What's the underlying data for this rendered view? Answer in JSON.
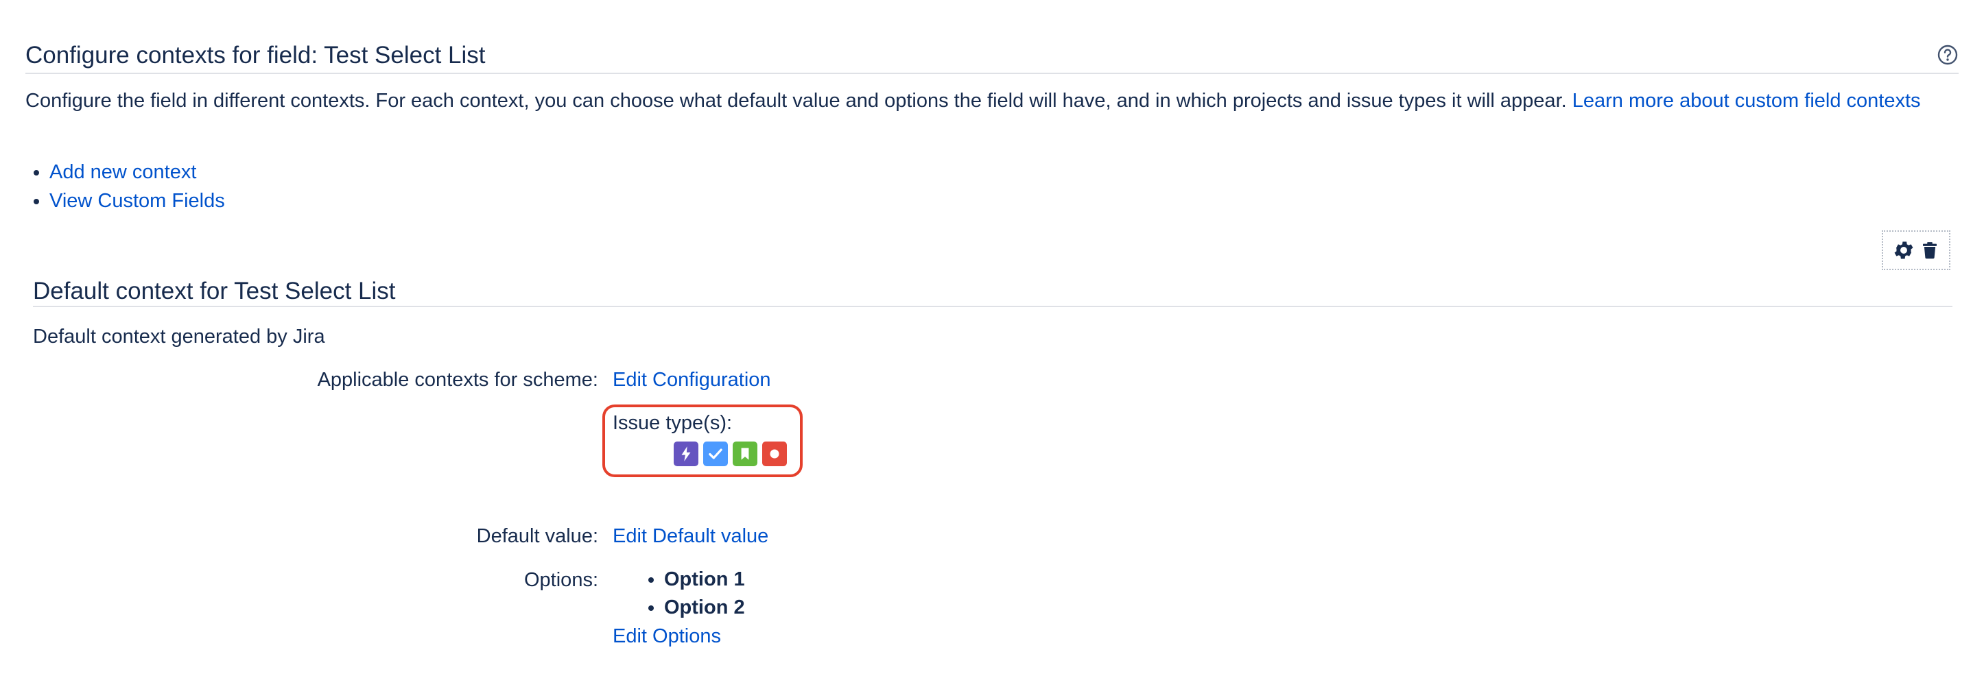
{
  "header": {
    "title": "Configure contexts for field: Test Select List",
    "help_icon": "help-question-circle-icon"
  },
  "description": {
    "text": "Configure the field in different contexts. For each context, you can choose what default value and options the field will have, and in which projects and issue types it will appear. ",
    "link": "Learn more about custom field contexts"
  },
  "links": [
    {
      "label": "Add new context"
    },
    {
      "label": "View Custom Fields"
    }
  ],
  "context_actions": {
    "configure_icon": "gear-icon",
    "delete_icon": "trash-icon"
  },
  "context": {
    "title": "Default context for Test Select List",
    "description": "Default context generated by Jira",
    "applicable_label": "Applicable contexts for scheme:",
    "edit_configuration": "Edit Configuration",
    "issue_types_label": "Issue type(s):",
    "issue_types": [
      {
        "icon": "epic-lightning-icon",
        "color": "#6554c0"
      },
      {
        "icon": "task-checkmark-icon",
        "color": "#4c9aff"
      },
      {
        "icon": "story-bookmark-icon",
        "color": "#63ba3c"
      },
      {
        "icon": "bug-circle-icon",
        "color": "#e5493a"
      }
    ],
    "default_value_label": "Default value:",
    "edit_default_value": "Edit Default value",
    "options_label": "Options:",
    "options": [
      "Option 1",
      "Option 2"
    ],
    "edit_options": "Edit Options"
  },
  "colors": {
    "link": "#0052cc",
    "text": "#172b4d",
    "highlight": "#e5402c"
  }
}
